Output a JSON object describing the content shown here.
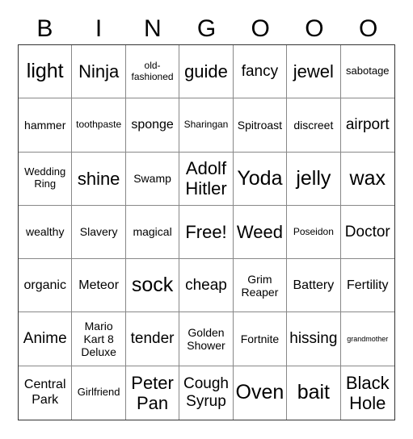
{
  "header": {
    "letters": [
      "B",
      "I",
      "N",
      "G",
      "O",
      "O",
      "O"
    ]
  },
  "board": {
    "rows": [
      [
        "light",
        "Ninja",
        "old-fashioned",
        "guide",
        "fancy",
        "jewel",
        "sabotage"
      ],
      [
        "hammer",
        "toothpaste",
        "sponge",
        "Sharingan",
        "Spitroast",
        "discreet",
        "airport"
      ],
      [
        "Wedding Ring",
        "shine",
        "Swamp",
        "Adolf Hitler",
        "Yoda",
        "jelly",
        "wax"
      ],
      [
        "wealthy",
        "Slavery",
        "magical",
        "Free!",
        "Weed",
        "Poseidon",
        "Doctor"
      ],
      [
        "organic",
        "Meteor",
        "sock",
        "cheap",
        "Grim Reaper",
        "Battery",
        "Fertility"
      ],
      [
        "Anime",
        "Mario Kart 8 Deluxe",
        "tender",
        "Golden Shower",
        "Fortnite",
        "hissing",
        "grandmother"
      ],
      [
        "Central Park",
        "Girlfriend",
        "Peter Pan",
        "Cough Syrup",
        "Oven",
        "bait",
        "Black Hole"
      ]
    ],
    "free_space": "Free!"
  },
  "colors": {
    "background": "#ffffff",
    "text": "#000000",
    "outer_border": "#333333",
    "inner_lines": "#888888"
  }
}
